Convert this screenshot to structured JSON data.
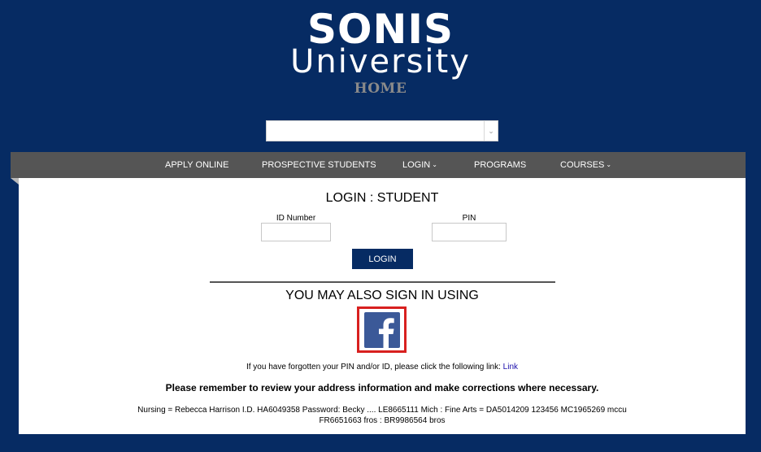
{
  "header": {
    "logo_line1": "SONIS",
    "logo_line2": "University",
    "home_label": "HOME",
    "select_value": ""
  },
  "nav": {
    "items": [
      {
        "label": "APPLY ONLINE",
        "has_dropdown": false
      },
      {
        "label": "PROSPECTIVE STUDENTS",
        "has_dropdown": false
      },
      {
        "label": "LOGIN",
        "has_dropdown": true
      },
      {
        "label": "PROGRAMS",
        "has_dropdown": false
      },
      {
        "label": "COURSES",
        "has_dropdown": true
      }
    ]
  },
  "login": {
    "title": "LOGIN : STUDENT",
    "id_label": "ID Number",
    "id_value": "",
    "pin_label": "PIN",
    "pin_value": "",
    "button_label": "LOGIN"
  },
  "alt_signin": {
    "heading": "YOU MAY ALSO SIGN IN USING",
    "provider_icon": "facebook-icon"
  },
  "forgot": {
    "text": "If you have forgotten your PIN and/or ID, please click the following link: ",
    "link_label": "Link"
  },
  "reminder": "Please remember to review your address information and make corrections where necessary.",
  "nursing_note": {
    "line1": "Nursing = Rebecca Harrison I.D. HA6049358 Password: Becky .... LE8665111 Mich : Fine Arts = DA5014209 123456 MC1965269 mccu",
    "line2": "FR6651663 fros : BR9986564 bros"
  },
  "colors": {
    "background": "#062b63",
    "nav_bar": "#555555",
    "button": "#062b63",
    "facebook": "#3b5998",
    "highlight": "#d8201f",
    "home_label": "#8a8a8a"
  }
}
